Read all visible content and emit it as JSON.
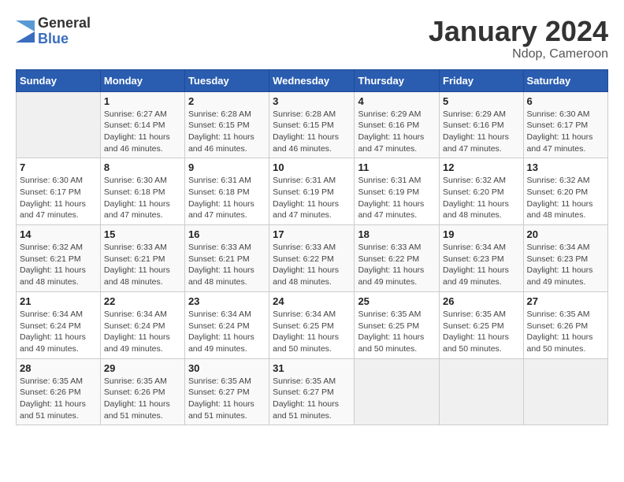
{
  "header": {
    "logo_general": "General",
    "logo_blue": "Blue",
    "month_title": "January 2024",
    "location": "Ndop, Cameroon"
  },
  "calendar": {
    "days_of_week": [
      "Sunday",
      "Monday",
      "Tuesday",
      "Wednesday",
      "Thursday",
      "Friday",
      "Saturday"
    ],
    "weeks": [
      [
        {
          "day": "",
          "info": ""
        },
        {
          "day": "1",
          "info": "Sunrise: 6:27 AM\nSunset: 6:14 PM\nDaylight: 11 hours\nand 46 minutes."
        },
        {
          "day": "2",
          "info": "Sunrise: 6:28 AM\nSunset: 6:15 PM\nDaylight: 11 hours\nand 46 minutes."
        },
        {
          "day": "3",
          "info": "Sunrise: 6:28 AM\nSunset: 6:15 PM\nDaylight: 11 hours\nand 46 minutes."
        },
        {
          "day": "4",
          "info": "Sunrise: 6:29 AM\nSunset: 6:16 PM\nDaylight: 11 hours\nand 47 minutes."
        },
        {
          "day": "5",
          "info": "Sunrise: 6:29 AM\nSunset: 6:16 PM\nDaylight: 11 hours\nand 47 minutes."
        },
        {
          "day": "6",
          "info": "Sunrise: 6:30 AM\nSunset: 6:17 PM\nDaylight: 11 hours\nand 47 minutes."
        }
      ],
      [
        {
          "day": "7",
          "info": "Sunrise: 6:30 AM\nSunset: 6:17 PM\nDaylight: 11 hours\nand 47 minutes."
        },
        {
          "day": "8",
          "info": "Sunrise: 6:30 AM\nSunset: 6:18 PM\nDaylight: 11 hours\nand 47 minutes."
        },
        {
          "day": "9",
          "info": "Sunrise: 6:31 AM\nSunset: 6:18 PM\nDaylight: 11 hours\nand 47 minutes."
        },
        {
          "day": "10",
          "info": "Sunrise: 6:31 AM\nSunset: 6:19 PM\nDaylight: 11 hours\nand 47 minutes."
        },
        {
          "day": "11",
          "info": "Sunrise: 6:31 AM\nSunset: 6:19 PM\nDaylight: 11 hours\nand 47 minutes."
        },
        {
          "day": "12",
          "info": "Sunrise: 6:32 AM\nSunset: 6:20 PM\nDaylight: 11 hours\nand 48 minutes."
        },
        {
          "day": "13",
          "info": "Sunrise: 6:32 AM\nSunset: 6:20 PM\nDaylight: 11 hours\nand 48 minutes."
        }
      ],
      [
        {
          "day": "14",
          "info": "Sunrise: 6:32 AM\nSunset: 6:21 PM\nDaylight: 11 hours\nand 48 minutes."
        },
        {
          "day": "15",
          "info": "Sunrise: 6:33 AM\nSunset: 6:21 PM\nDaylight: 11 hours\nand 48 minutes."
        },
        {
          "day": "16",
          "info": "Sunrise: 6:33 AM\nSunset: 6:21 PM\nDaylight: 11 hours\nand 48 minutes."
        },
        {
          "day": "17",
          "info": "Sunrise: 6:33 AM\nSunset: 6:22 PM\nDaylight: 11 hours\nand 48 minutes."
        },
        {
          "day": "18",
          "info": "Sunrise: 6:33 AM\nSunset: 6:22 PM\nDaylight: 11 hours\nand 49 minutes."
        },
        {
          "day": "19",
          "info": "Sunrise: 6:34 AM\nSunset: 6:23 PM\nDaylight: 11 hours\nand 49 minutes."
        },
        {
          "day": "20",
          "info": "Sunrise: 6:34 AM\nSunset: 6:23 PM\nDaylight: 11 hours\nand 49 minutes."
        }
      ],
      [
        {
          "day": "21",
          "info": "Sunrise: 6:34 AM\nSunset: 6:24 PM\nDaylight: 11 hours\nand 49 minutes."
        },
        {
          "day": "22",
          "info": "Sunrise: 6:34 AM\nSunset: 6:24 PM\nDaylight: 11 hours\nand 49 minutes."
        },
        {
          "day": "23",
          "info": "Sunrise: 6:34 AM\nSunset: 6:24 PM\nDaylight: 11 hours\nand 49 minutes."
        },
        {
          "day": "24",
          "info": "Sunrise: 6:34 AM\nSunset: 6:25 PM\nDaylight: 11 hours\nand 50 minutes."
        },
        {
          "day": "25",
          "info": "Sunrise: 6:35 AM\nSunset: 6:25 PM\nDaylight: 11 hours\nand 50 minutes."
        },
        {
          "day": "26",
          "info": "Sunrise: 6:35 AM\nSunset: 6:25 PM\nDaylight: 11 hours\nand 50 minutes."
        },
        {
          "day": "27",
          "info": "Sunrise: 6:35 AM\nSunset: 6:26 PM\nDaylight: 11 hours\nand 50 minutes."
        }
      ],
      [
        {
          "day": "28",
          "info": "Sunrise: 6:35 AM\nSunset: 6:26 PM\nDaylight: 11 hours\nand 51 minutes."
        },
        {
          "day": "29",
          "info": "Sunrise: 6:35 AM\nSunset: 6:26 PM\nDaylight: 11 hours\nand 51 minutes."
        },
        {
          "day": "30",
          "info": "Sunrise: 6:35 AM\nSunset: 6:27 PM\nDaylight: 11 hours\nand 51 minutes."
        },
        {
          "day": "31",
          "info": "Sunrise: 6:35 AM\nSunset: 6:27 PM\nDaylight: 11 hours\nand 51 minutes."
        },
        {
          "day": "",
          "info": ""
        },
        {
          "day": "",
          "info": ""
        },
        {
          "day": "",
          "info": ""
        }
      ]
    ]
  }
}
